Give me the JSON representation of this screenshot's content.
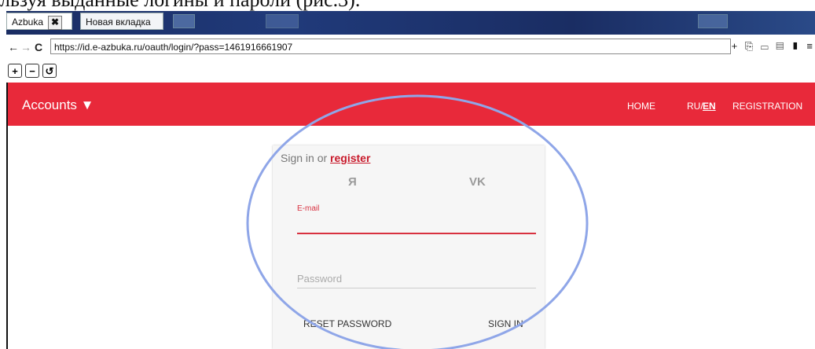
{
  "caption": "льзуя выданные логины и пароли (рис.3).",
  "tabs": [
    {
      "label": "Azbuka",
      "active": true
    },
    {
      "label": "Новая вкладка",
      "active": false
    }
  ],
  "tab_close_glyph": "✖",
  "url": "https://id.e-azbuka.ru/oauth/login/?pass=1461916661907",
  "nav": {
    "back": "←",
    "forward": "→",
    "reload": "C"
  },
  "nav_icons": "+ ⎘ ▭ ▤ ▮ ≡",
  "zoom": {
    "in": "+",
    "out": "−",
    "reset": "↺"
  },
  "header": {
    "brand": "Accounts ▼",
    "home": "HOME",
    "lang_ru": "RU/",
    "lang_en": "EN",
    "registration": "REGISTRATION"
  },
  "login": {
    "signin_prefix": "Sign in or ",
    "register_link": "register",
    "social_ya": "Я",
    "social_vk": "VK",
    "email_label": "E-mail",
    "password_placeholder": "Password",
    "reset_button": "RESET PASSWORD",
    "signin_button": "SIGN IN"
  },
  "colors": {
    "header": "#e8293a",
    "accent": "#d83140",
    "highlight_oval": "#8fa6e8"
  }
}
